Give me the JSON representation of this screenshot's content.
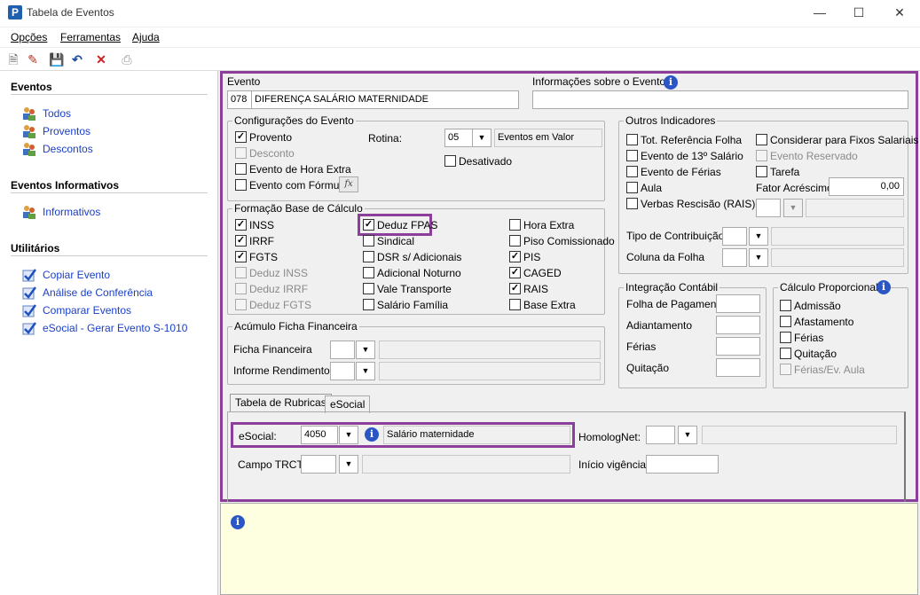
{
  "window": {
    "title": "Tabela de Eventos",
    "app_icon": "P"
  },
  "menu": {
    "opcoes": "Opções",
    "ferramentas": "Ferramentas",
    "ajuda": "Ajuda"
  },
  "sidebar": {
    "eventos": {
      "heading": "Eventos",
      "items": [
        "Todos",
        "Proventos",
        "Descontos"
      ]
    },
    "informativos": {
      "heading": "Eventos Informativos",
      "items": [
        "Informativos"
      ]
    },
    "utilitarios": {
      "heading": "Utilitários",
      "items": [
        "Copiar Evento",
        "Análise de Conferência",
        "Comparar Eventos",
        "eSocial - Gerar Evento S-1010"
      ]
    }
  },
  "evento": {
    "label": "Evento",
    "codigo": "078",
    "descricao": "DIFERENÇA SALÁRIO MATERNIDADE",
    "info_label": "Informações sobre o Evento",
    "info_value": ""
  },
  "configuracoes": {
    "title": "Configurações do Evento",
    "provento": "Provento",
    "desconto": "Desconto",
    "hora_extra": "Evento de Hora Extra",
    "formula": "Evento com Fórmula",
    "rotina_label": "Rotina:",
    "rotina_value": "05",
    "rotina_desc": "Eventos em Valor",
    "desativado": "Desativado",
    "formula_btn": "fx"
  },
  "outros": {
    "title": "Outros Indicadores",
    "tot_ref": "Tot. Referência Folha",
    "decimo": "Evento de 13º Salário",
    "ferias": "Evento de Férias",
    "aula": "Aula",
    "verbas": "Verbas Rescisão (RAIS)",
    "considerar": "Considerar para Fixos Salariais",
    "reservado": "Evento Reservado",
    "tarefa": "Tarefa",
    "fator_label": "Fator Acréscimo",
    "fator_value": "0,00",
    "tipo_contrib": "Tipo de Contribuição",
    "coluna_folha": "Coluna da Folha"
  },
  "formacao": {
    "title": "Formação Base de Cálculo",
    "col1": [
      "INSS",
      "IRRF",
      "FGTS",
      "Deduz INSS",
      "Deduz IRRF",
      "Deduz FGTS"
    ],
    "col2": [
      "Deduz FPAS",
      "Sindical",
      "DSR s/ Adicionais",
      "Adicional Noturno",
      "Vale Transporte",
      "Salário Família"
    ],
    "col3": [
      "Hora Extra",
      "Piso Comissionado",
      "PIS",
      "CAGED",
      "RAIS",
      "Base Extra"
    ]
  },
  "acumulo": {
    "title": "Acúmulo Ficha Financeira",
    "ficha": "Ficha Financeira",
    "informe": "Informe Rendimentos"
  },
  "integracao": {
    "title": "Integração Contábil",
    "folha": "Folha de Pagamento",
    "adiantamento": "Adiantamento",
    "ferias": "Férias",
    "quitacao": "Quitação"
  },
  "proporcional": {
    "title": "Cálculo Proporcional",
    "items": [
      "Admissão",
      "Afastamento",
      "Férias",
      "Quitação",
      "Férias/Ev. Aula"
    ]
  },
  "tabs": {
    "rubricas": "Tabela de Rubricas",
    "esocial": "eSocial"
  },
  "rubricas": {
    "esocial_label": "eSocial:",
    "esocial_value": "4050",
    "esocial_desc": "Salário maternidade",
    "homolog_label": "HomologNet:",
    "campo_trct": "Campo TRCT:",
    "inicio_vig": "Início vigência:"
  },
  "colors": {
    "highlight": "#8b3f9b",
    "link": "#1a3fc8",
    "notes_bg": "#fefee0"
  }
}
